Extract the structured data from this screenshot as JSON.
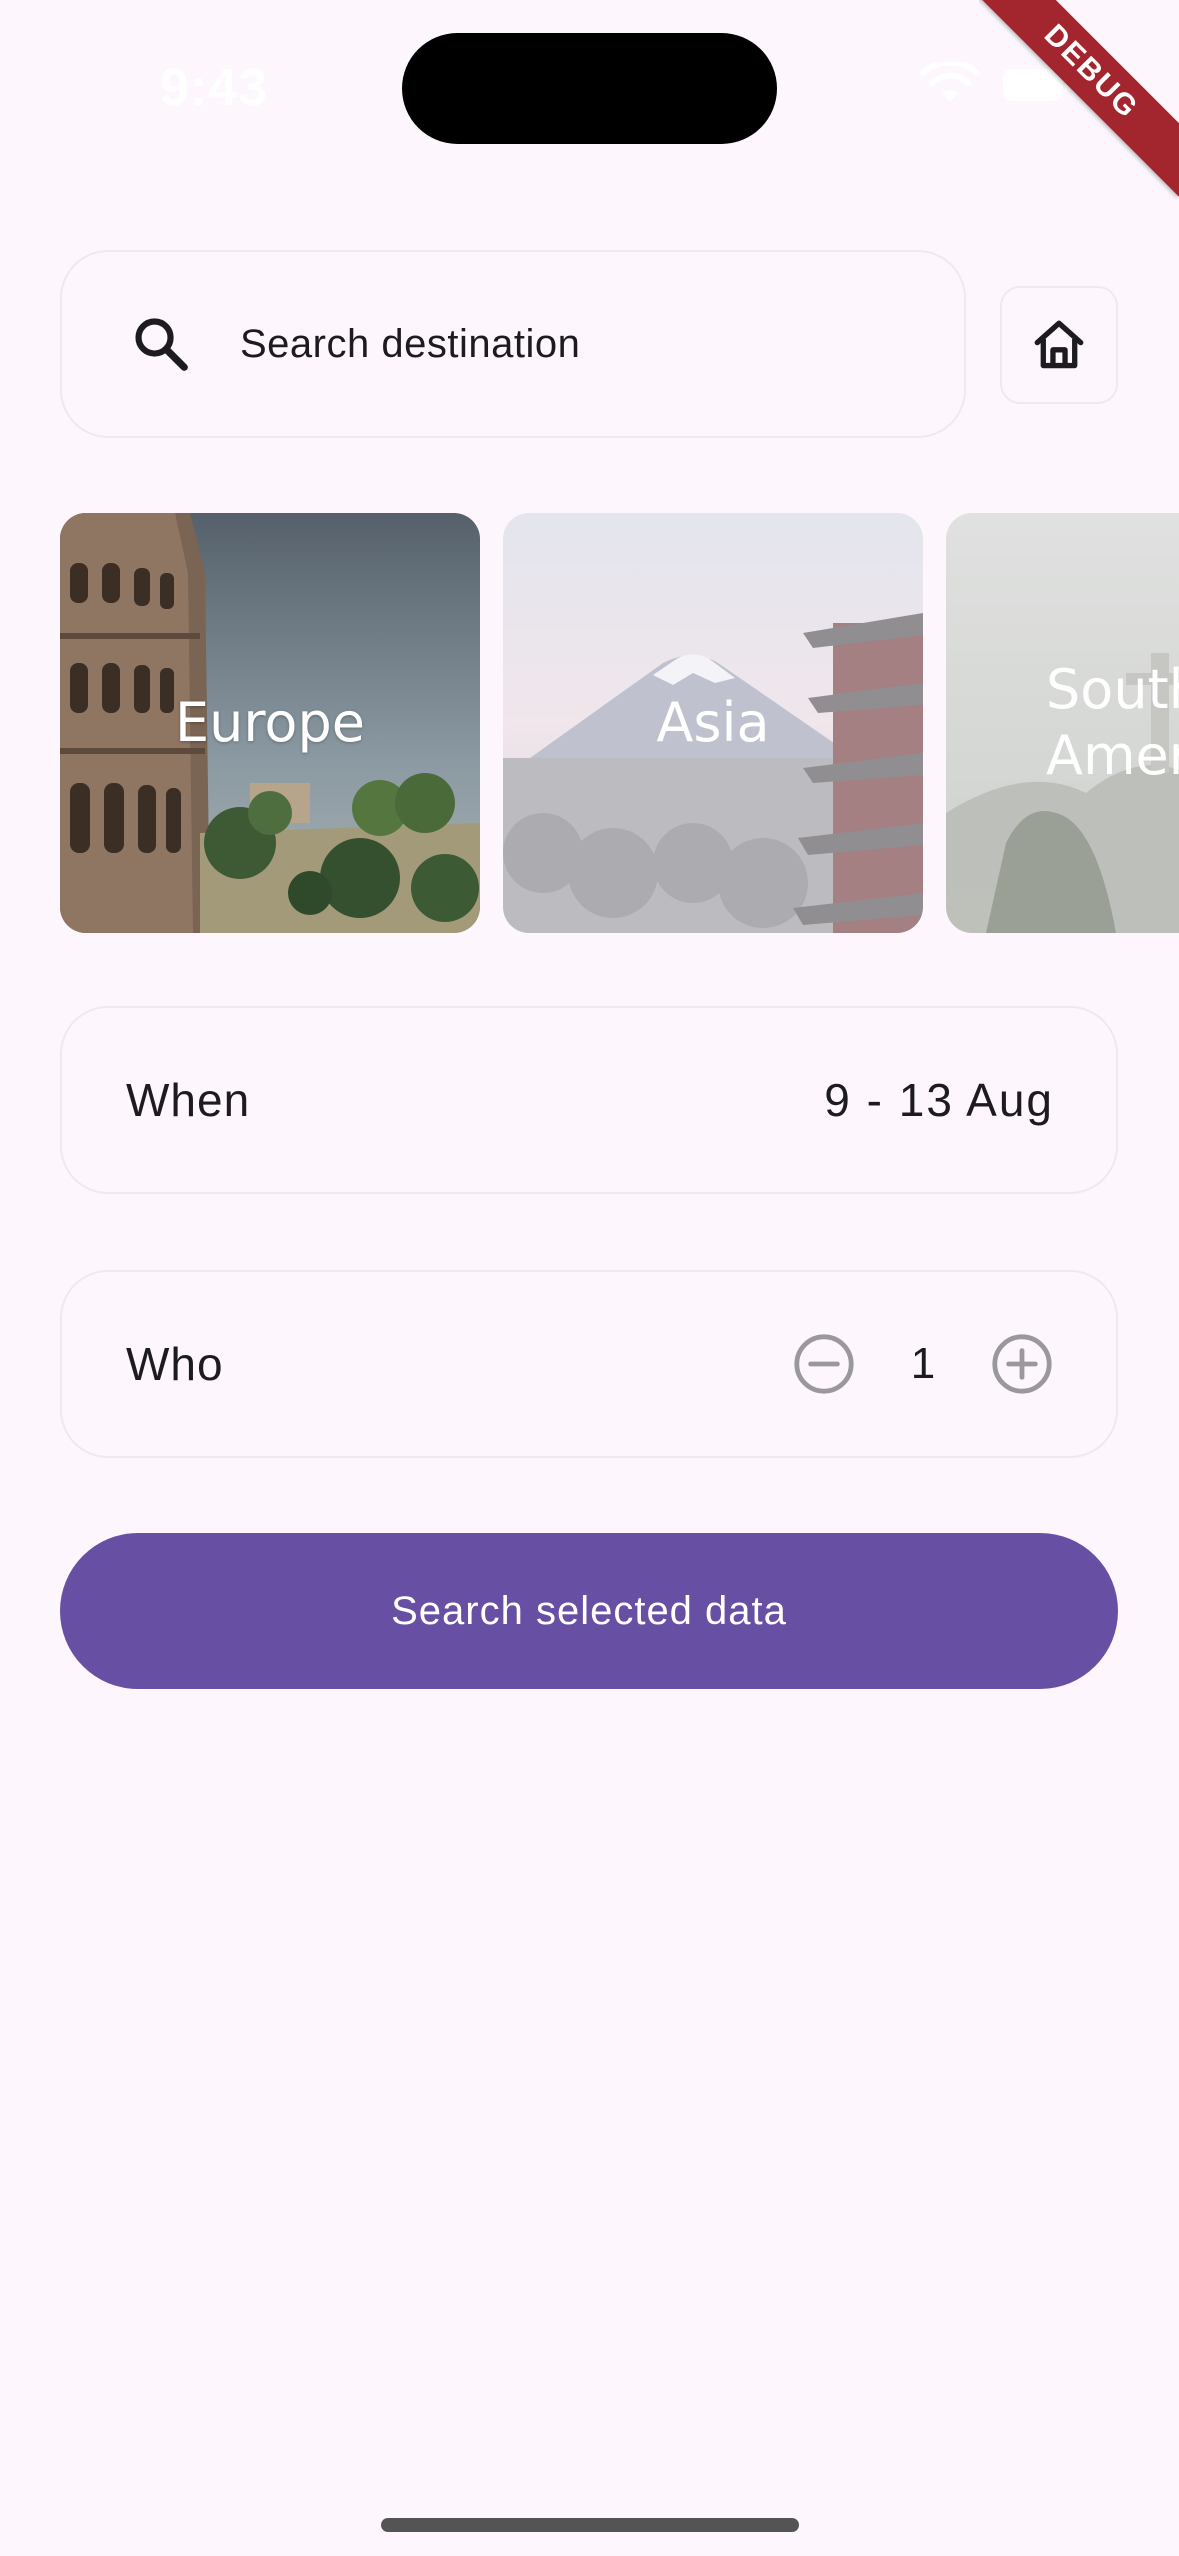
{
  "status_bar": {
    "time": "9:43"
  },
  "debug_banner": "DEBUG",
  "search": {
    "placeholder": "Search destination",
    "icon": "search-icon"
  },
  "home_button": {
    "icon": "home-icon"
  },
  "destinations": [
    {
      "label": "Europe",
      "selected": true
    },
    {
      "label": "Asia",
      "selected": false
    },
    {
      "label": "South America",
      "selected": false
    }
  ],
  "when": {
    "label": "When",
    "value": "9 - 13 Aug"
  },
  "who": {
    "label": "Who",
    "count": "1",
    "decrement_icon": "minus-circle-icon",
    "increment_icon": "plus-circle-icon"
  },
  "primary_action": {
    "label": "Search selected data"
  },
  "colors": {
    "background": "#fdf7fd",
    "primary": "#6750a4",
    "border": "#f0e8f1",
    "debug_ribbon": "#a3262f"
  }
}
